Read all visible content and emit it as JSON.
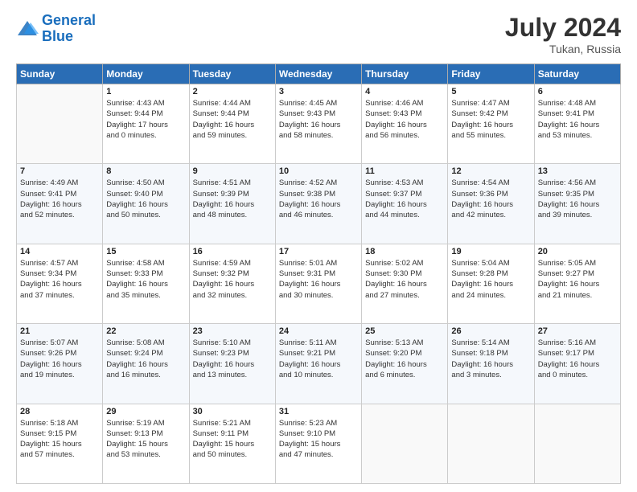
{
  "header": {
    "logo_line1": "General",
    "logo_line2": "Blue",
    "month_year": "July 2024",
    "location": "Tukan, Russia"
  },
  "columns": [
    "Sunday",
    "Monday",
    "Tuesday",
    "Wednesday",
    "Thursday",
    "Friday",
    "Saturday"
  ],
  "weeks": [
    [
      {
        "day": "",
        "info": ""
      },
      {
        "day": "1",
        "info": "Sunrise: 4:43 AM\nSunset: 9:44 PM\nDaylight: 17 hours\nand 0 minutes."
      },
      {
        "day": "2",
        "info": "Sunrise: 4:44 AM\nSunset: 9:44 PM\nDaylight: 16 hours\nand 59 minutes."
      },
      {
        "day": "3",
        "info": "Sunrise: 4:45 AM\nSunset: 9:43 PM\nDaylight: 16 hours\nand 58 minutes."
      },
      {
        "day": "4",
        "info": "Sunrise: 4:46 AM\nSunset: 9:43 PM\nDaylight: 16 hours\nand 56 minutes."
      },
      {
        "day": "5",
        "info": "Sunrise: 4:47 AM\nSunset: 9:42 PM\nDaylight: 16 hours\nand 55 minutes."
      },
      {
        "day": "6",
        "info": "Sunrise: 4:48 AM\nSunset: 9:41 PM\nDaylight: 16 hours\nand 53 minutes."
      }
    ],
    [
      {
        "day": "7",
        "info": "Sunrise: 4:49 AM\nSunset: 9:41 PM\nDaylight: 16 hours\nand 52 minutes."
      },
      {
        "day": "8",
        "info": "Sunrise: 4:50 AM\nSunset: 9:40 PM\nDaylight: 16 hours\nand 50 minutes."
      },
      {
        "day": "9",
        "info": "Sunrise: 4:51 AM\nSunset: 9:39 PM\nDaylight: 16 hours\nand 48 minutes."
      },
      {
        "day": "10",
        "info": "Sunrise: 4:52 AM\nSunset: 9:38 PM\nDaylight: 16 hours\nand 46 minutes."
      },
      {
        "day": "11",
        "info": "Sunrise: 4:53 AM\nSunset: 9:37 PM\nDaylight: 16 hours\nand 44 minutes."
      },
      {
        "day": "12",
        "info": "Sunrise: 4:54 AM\nSunset: 9:36 PM\nDaylight: 16 hours\nand 42 minutes."
      },
      {
        "day": "13",
        "info": "Sunrise: 4:56 AM\nSunset: 9:35 PM\nDaylight: 16 hours\nand 39 minutes."
      }
    ],
    [
      {
        "day": "14",
        "info": "Sunrise: 4:57 AM\nSunset: 9:34 PM\nDaylight: 16 hours\nand 37 minutes."
      },
      {
        "day": "15",
        "info": "Sunrise: 4:58 AM\nSunset: 9:33 PM\nDaylight: 16 hours\nand 35 minutes."
      },
      {
        "day": "16",
        "info": "Sunrise: 4:59 AM\nSunset: 9:32 PM\nDaylight: 16 hours\nand 32 minutes."
      },
      {
        "day": "17",
        "info": "Sunrise: 5:01 AM\nSunset: 9:31 PM\nDaylight: 16 hours\nand 30 minutes."
      },
      {
        "day": "18",
        "info": "Sunrise: 5:02 AM\nSunset: 9:30 PM\nDaylight: 16 hours\nand 27 minutes."
      },
      {
        "day": "19",
        "info": "Sunrise: 5:04 AM\nSunset: 9:28 PM\nDaylight: 16 hours\nand 24 minutes."
      },
      {
        "day": "20",
        "info": "Sunrise: 5:05 AM\nSunset: 9:27 PM\nDaylight: 16 hours\nand 21 minutes."
      }
    ],
    [
      {
        "day": "21",
        "info": "Sunrise: 5:07 AM\nSunset: 9:26 PM\nDaylight: 16 hours\nand 19 minutes."
      },
      {
        "day": "22",
        "info": "Sunrise: 5:08 AM\nSunset: 9:24 PM\nDaylight: 16 hours\nand 16 minutes."
      },
      {
        "day": "23",
        "info": "Sunrise: 5:10 AM\nSunset: 9:23 PM\nDaylight: 16 hours\nand 13 minutes."
      },
      {
        "day": "24",
        "info": "Sunrise: 5:11 AM\nSunset: 9:21 PM\nDaylight: 16 hours\nand 10 minutes."
      },
      {
        "day": "25",
        "info": "Sunrise: 5:13 AM\nSunset: 9:20 PM\nDaylight: 16 hours\nand 6 minutes."
      },
      {
        "day": "26",
        "info": "Sunrise: 5:14 AM\nSunset: 9:18 PM\nDaylight: 16 hours\nand 3 minutes."
      },
      {
        "day": "27",
        "info": "Sunrise: 5:16 AM\nSunset: 9:17 PM\nDaylight: 16 hours\nand 0 minutes."
      }
    ],
    [
      {
        "day": "28",
        "info": "Sunrise: 5:18 AM\nSunset: 9:15 PM\nDaylight: 15 hours\nand 57 minutes."
      },
      {
        "day": "29",
        "info": "Sunrise: 5:19 AM\nSunset: 9:13 PM\nDaylight: 15 hours\nand 53 minutes."
      },
      {
        "day": "30",
        "info": "Sunrise: 5:21 AM\nSunset: 9:11 PM\nDaylight: 15 hours\nand 50 minutes."
      },
      {
        "day": "31",
        "info": "Sunrise: 5:23 AM\nSunset: 9:10 PM\nDaylight: 15 hours\nand 47 minutes."
      },
      {
        "day": "",
        "info": ""
      },
      {
        "day": "",
        "info": ""
      },
      {
        "day": "",
        "info": ""
      }
    ]
  ]
}
